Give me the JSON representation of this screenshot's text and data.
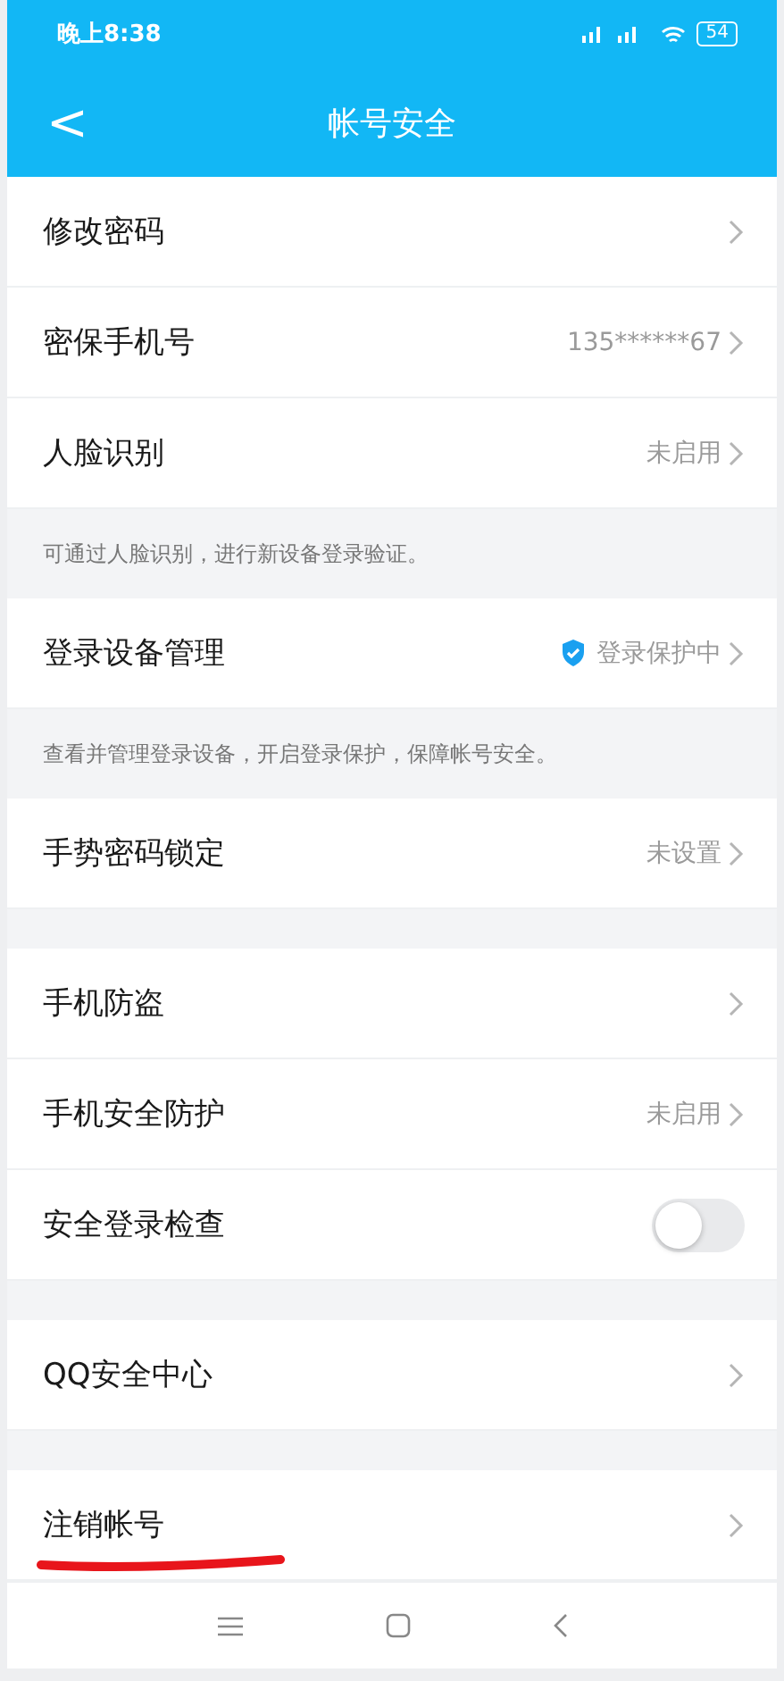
{
  "status_bar": {
    "time": "晚上8:38",
    "battery": "54"
  },
  "header": {
    "back": "<",
    "title": "帐号安全"
  },
  "sections": [
    {
      "rows": [
        {
          "kind": "link",
          "label": "修改密码"
        },
        {
          "kind": "link",
          "label": "密保手机号",
          "value": "135******67"
        },
        {
          "kind": "link",
          "label": "人脸识别",
          "value": "未启用"
        }
      ],
      "note": "可通过人脸识别，进行新设备登录验证。"
    },
    {
      "rows": [
        {
          "kind": "link",
          "label": "登录设备管理",
          "value": "登录保护中",
          "verified": true
        }
      ],
      "note": "查看并管理登录设备，开启登录保护，保障帐号安全。"
    },
    {
      "rows": [
        {
          "kind": "link",
          "label": "手势密码锁定",
          "value": "未设置"
        }
      ]
    },
    {
      "rows": [
        {
          "kind": "link",
          "label": "手机防盗"
        },
        {
          "kind": "link",
          "label": "手机安全防护",
          "value": "未启用"
        },
        {
          "kind": "toggle",
          "label": "安全登录检查",
          "on": false
        }
      ]
    },
    {
      "rows": [
        {
          "kind": "link",
          "label": "QQ安全中心"
        }
      ]
    },
    {
      "rows": [
        {
          "kind": "link",
          "label": "注销帐号",
          "underlined": true
        }
      ]
    }
  ]
}
